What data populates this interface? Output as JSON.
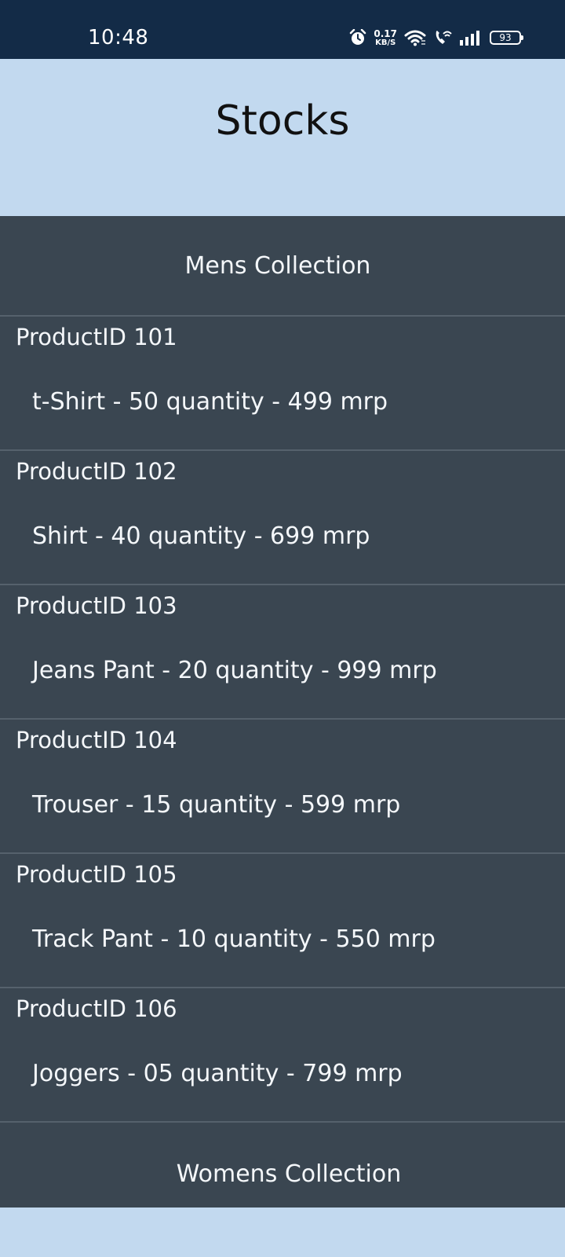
{
  "status_bar": {
    "time": "10:48",
    "net_speed_value": "0.17",
    "net_speed_unit": "KB/S",
    "battery": "93",
    "icons": [
      "alarm-icon",
      "wifi-icon",
      "wifi-calling-icon",
      "signal-icon",
      "battery-icon"
    ]
  },
  "header": {
    "title": "Stocks"
  },
  "mens_collection": {
    "title": "Mens Collection",
    "products": [
      {
        "id": "ProductID 101",
        "details": "t-Shirt - 50 quantity - 499 mrp"
      },
      {
        "id": "ProductID 102",
        "details": "Shirt - 40 quantity - 699 mrp"
      },
      {
        "id": "ProductID 103",
        "details": "Jeans Pant - 20 quantity - 999 mrp"
      },
      {
        "id": "ProductID 104",
        "details": "Trouser - 15 quantity - 599 mrp"
      },
      {
        "id": "ProductID 105",
        "details": "Track Pant - 10 quantity - 550 mrp"
      },
      {
        "id": "ProductID 106",
        "details": "Joggers - 05 quantity - 799 mrp"
      }
    ]
  },
  "womens_collection": {
    "title": "Womens Collection"
  },
  "colors": {
    "status_bar": "#132b47",
    "header_background": "#c2d9ef",
    "panel_background": "#3a4651",
    "divider": "#55616c"
  }
}
